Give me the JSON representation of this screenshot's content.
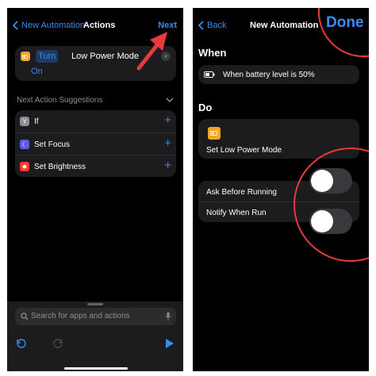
{
  "left": {
    "nav": {
      "back_label": "New Automation",
      "title": "Actions",
      "next_label": "Next"
    },
    "action": {
      "verb": "Turn",
      "target": "Low Power Mode",
      "state": "On"
    },
    "suggestions": {
      "header": "Next Action Suggestions",
      "items": [
        {
          "label": "If",
          "icon": "y-branch-icon",
          "color": "#8e8e93"
        },
        {
          "label": "Set Focus",
          "icon": "moon-icon",
          "color": "#5e5ce6"
        },
        {
          "label": "Set Brightness",
          "icon": "sun-icon",
          "color": "#ff3b30"
        }
      ]
    },
    "search": {
      "placeholder": "Search for apps and actions"
    }
  },
  "right": {
    "nav": {
      "back_label": "Back",
      "title": "New Automation",
      "done_label": "Done"
    },
    "when": {
      "header": "When",
      "condition": "When battery level is 50%"
    },
    "do": {
      "header": "Do",
      "action": "Set Low Power Mode"
    },
    "settings": [
      {
        "label": "Ask Before Running",
        "enabled": false
      },
      {
        "label": "Notify When Run",
        "enabled": false
      }
    ]
  },
  "colors": {
    "accent": "#3b8bf5",
    "annotation": "#e83a3a",
    "low_power": "#f5a623"
  }
}
